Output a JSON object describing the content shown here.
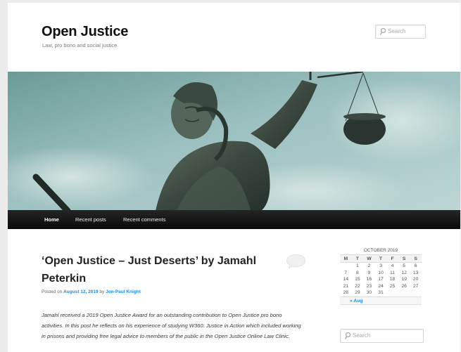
{
  "header": {
    "site_title": "Open Justice",
    "site_description": "Law, pro bono and social justice",
    "search_placeholder": "Search"
  },
  "banner": {
    "icon": "lady-justice-statue-image"
  },
  "nav": {
    "items": [
      {
        "label": "Home",
        "current": true
      },
      {
        "label": "Recent posts",
        "current": false
      },
      {
        "label": "Recent comments",
        "current": false
      }
    ]
  },
  "post": {
    "title": "‘Open Justice – Just Deserts’ by Jamahl Peterkin",
    "posted_on": "Posted on",
    "date": "August 12, 2019",
    "by": "by",
    "author": "Jon-Paul Knight",
    "excerpt": "Jamahl received a 2019 Open Justice Award for an outstanding contribution to Open Justice pro bono activities. In this post he reflects on his experience of studying W360: Justice in Action which included working in prisons and providing free legal advice to members of the public in the Open Justice Online Law Clinic."
  },
  "calendar": {
    "caption": "OCTOBER 2019",
    "weekdays": [
      "M",
      "T",
      "W",
      "T",
      "F",
      "S",
      "S"
    ],
    "weeks": [
      [
        "",
        "1",
        "2",
        "3",
        "4",
        "5",
        "6"
      ],
      [
        "7",
        "8",
        "9",
        "10",
        "11",
        "12",
        "13"
      ],
      [
        "14",
        "15",
        "16",
        "17",
        "18",
        "19",
        "20"
      ],
      [
        "21",
        "22",
        "23",
        "24",
        "25",
        "26",
        "27"
      ],
      [
        "28",
        "29",
        "30",
        "31",
        "",
        "",
        ""
      ]
    ],
    "prev_link": "« Aug"
  },
  "sidebar": {
    "search_placeholder": "Search"
  },
  "colors": {
    "link": "#1b8be0",
    "nav_bg": "#111111",
    "page_bg": "#ececec"
  }
}
